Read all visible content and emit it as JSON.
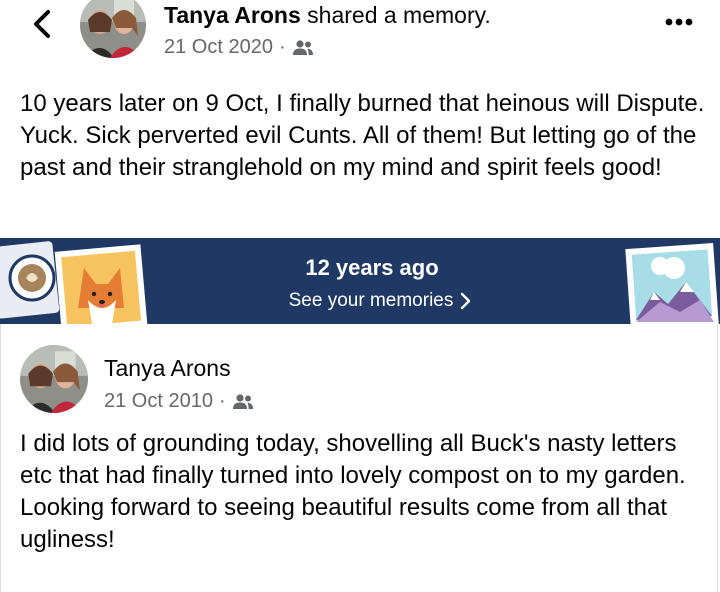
{
  "header": {
    "author": "Tanya Arons",
    "action": "shared a memory.",
    "date": "21 Oct 2020",
    "audience_icon": "friends-icon",
    "more_icon": "more-horizontal-icon"
  },
  "post1": {
    "text": "10 years later on 9 Oct, I finally burned that heinous will Dispute.  Yuck.  Sick perverted evil Cunts.  All of them!  But letting go of the past and their stranglehold on my mind and spirit feels good!"
  },
  "banner": {
    "title": "12 years ago",
    "link": "See your memories",
    "color": "#1f3864"
  },
  "memory": {
    "author": "Tanya Arons",
    "date": "21 Oct 2010",
    "audience_icon": "friends-icon",
    "text": "I did lots of grounding today, shovelling all Buck's nasty letters etc that had finally turned into lovely compost on to my garden.  Looking forward to seeing beautiful results come from all that ugliness!"
  },
  "colors": {
    "secondary_text": "#65676b",
    "banner_bg": "#1f3864"
  }
}
